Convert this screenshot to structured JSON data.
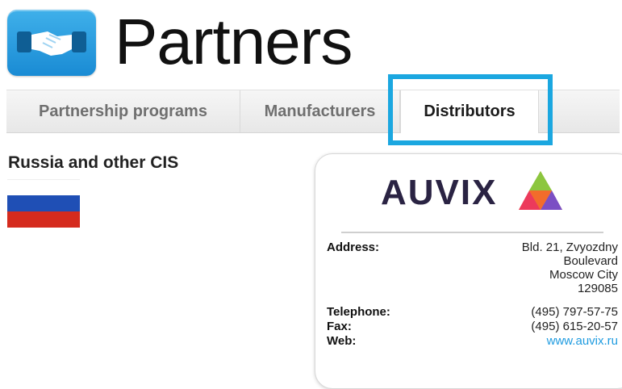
{
  "header": {
    "title": "Partners",
    "logo_icon": "handshake-icon",
    "logo_color": "#2fa3e6"
  },
  "tabs": [
    {
      "label": "Partnership programs",
      "active": false
    },
    {
      "label": "Manufacturers",
      "active": false
    },
    {
      "label": "Distributors",
      "active": true
    }
  ],
  "highlight_color": "#1ba7e0",
  "region": {
    "title": "Russia and other CIS",
    "flag_icon": "russia-flag-icon",
    "flag_colors": [
      "#ffffff",
      "#1f4fb5",
      "#d52b1e"
    ]
  },
  "distributor": {
    "brand": "AUVIX",
    "brand_color": "#2a2343",
    "address_label": "Address:",
    "address_lines": [
      "Bld. 21, Zvyozdny",
      "Boulevard",
      "Moscow City",
      "129085"
    ],
    "telephone_label": "Telephone:",
    "telephone": "(495) 797-57-75",
    "fax_label": "Fax:",
    "fax": "(495) 615-20-57",
    "web_label": "Web:",
    "web": "www.auvix.ru",
    "link_color": "#1e9be0"
  }
}
